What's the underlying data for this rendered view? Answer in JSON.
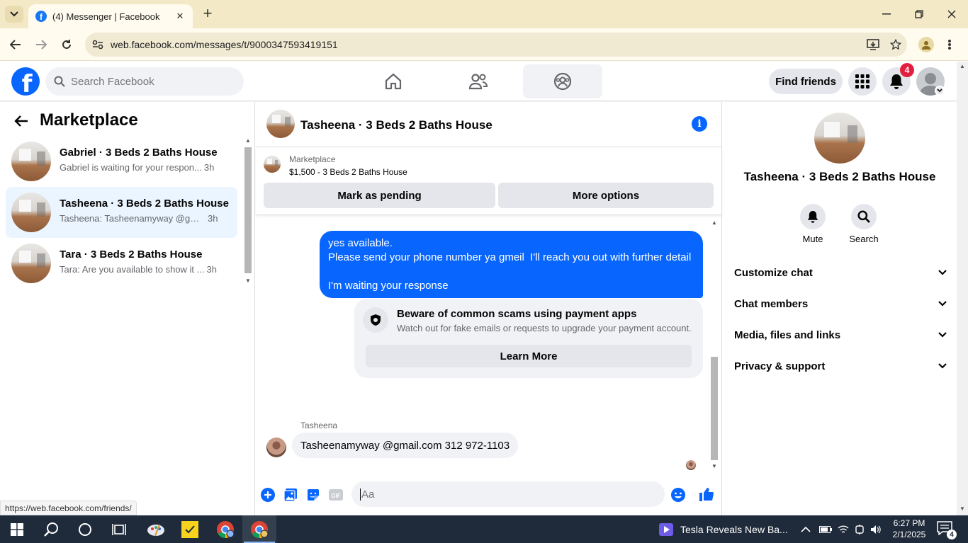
{
  "browser": {
    "tab_title": "(4) Messenger | Facebook",
    "url": "web.facebook.com/messages/t/9000347593419151",
    "status_url": "https://web.facebook.com/friends/"
  },
  "header": {
    "search_placeholder": "Search Facebook",
    "find_friends": "Find friends",
    "notification_count": "4"
  },
  "sidebar": {
    "title": "Marketplace",
    "conversations": [
      {
        "title": "Gabriel · 3 Beds 2 Baths House",
        "preview": "Gabriel is waiting for your respon...",
        "time": "3h"
      },
      {
        "title": "Tasheena · 3 Beds 2 Baths House",
        "preview": "Tasheena: Tasheenamyway @gmail...",
        "time": "3h"
      },
      {
        "title": "Tara · 3 Beds 2 Baths House",
        "preview": "Tara: Are you available to show it ...",
        "time": "3h"
      }
    ]
  },
  "chat": {
    "title": "Tasheena · 3 Beds 2 Baths House",
    "listing_source": "Marketplace",
    "listing_price": "$1,500 - 3 Beds 2 Baths House",
    "mark_pending": "Mark as pending",
    "more_options": "More options",
    "outgoing_lines": [
      "yes available.",
      "Please send your phone number ya gmeil  I'll reach you out with further detail",
      "",
      "I'm waiting your response"
    ],
    "scam_title": "Beware of common scams using payment apps",
    "scam_text": "Watch out for fake emails or requests to upgrade your payment account.",
    "learn_more": "Learn More",
    "incoming_sender": "Tasheena",
    "incoming_message": "Tasheenamyway @gmail.com 312 972-1103",
    "composer_placeholder": "Aa"
  },
  "details": {
    "name": "Tasheena · 3 Beds 2 Baths House",
    "mute": "Mute",
    "search": "Search",
    "sections": [
      "Customize chat",
      "Chat members",
      "Media, files and links",
      "Privacy & support"
    ]
  },
  "taskbar": {
    "news": "Tesla Reveals New Ba...",
    "time": "6:27 PM",
    "date": "2/1/2025",
    "notifications": "4"
  }
}
